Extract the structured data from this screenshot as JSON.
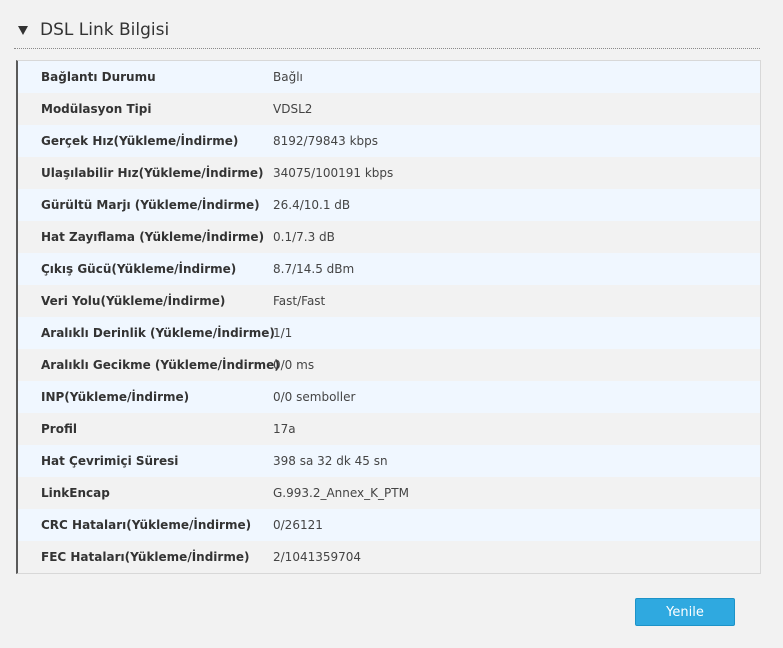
{
  "section": {
    "title": "DSL Link Bilgisi",
    "toggle_icon": "triangle-down-icon"
  },
  "rows": [
    {
      "label": "Bağlantı Durumu",
      "value": "Bağlı"
    },
    {
      "label": "Modülasyon Tipi",
      "value": "VDSL2"
    },
    {
      "label": "Gerçek Hız(Yükleme/İndirme)",
      "value": "8192/79843 kbps"
    },
    {
      "label": "Ulaşılabilir Hız(Yükleme/İndirme)",
      "value": "34075/100191 kbps"
    },
    {
      "label": "Gürültü Marjı (Yükleme/İndirme)",
      "value": "26.4/10.1 dB"
    },
    {
      "label": "Hat Zayıflama (Yükleme/İndirme)",
      "value": "0.1/7.3 dB"
    },
    {
      "label": "Çıkış Gücü(Yükleme/İndirme)",
      "value": "8.7/14.5 dBm"
    },
    {
      "label": "Veri Yolu(Yükleme/İndirme)",
      "value": "Fast/Fast"
    },
    {
      "label": "Aralıklı Derinlik (Yükleme/İndirme)",
      "value": "1/1"
    },
    {
      "label": "Aralıklı Gecikme (Yükleme/İndirme)",
      "value": "0/0 ms"
    },
    {
      "label": "INP(Yükleme/İndirme)",
      "value": "0/0 semboller"
    },
    {
      "label": "Profil",
      "value": "17a"
    },
    {
      "label": "Hat Çevrimiçi Süresi",
      "value": "398 sa 32 dk 45 sn"
    },
    {
      "label": "LinkEncap",
      "value": "G.993.2_Annex_K_PTM"
    },
    {
      "label": "CRC Hataları(Yükleme/İndirme)",
      "value": "0/26121"
    },
    {
      "label": "FEC Hataları(Yükleme/İndirme)",
      "value": "2/1041359704"
    }
  ],
  "actions": {
    "refresh_label": "Yenile"
  },
  "colors": {
    "accent": "#2fa9e0",
    "row_odd": "#f0f7ff",
    "row_even": "#f2f2f2"
  }
}
